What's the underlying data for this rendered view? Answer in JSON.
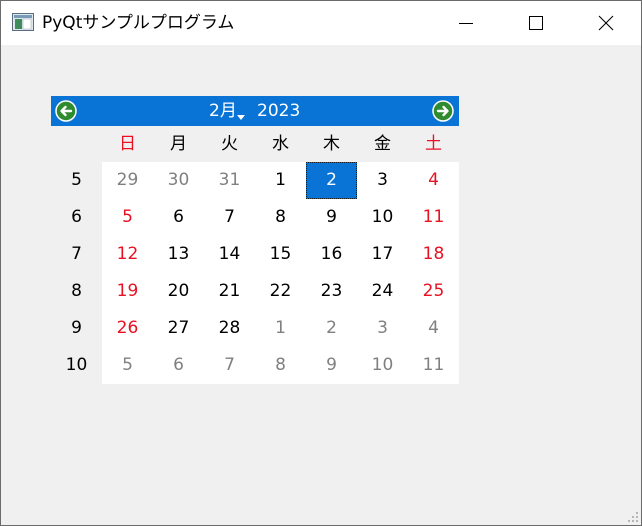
{
  "window": {
    "title": "PyQtサンプルプログラム"
  },
  "calendar": {
    "month": "2月",
    "year": "2023",
    "weekday_headers": [
      "日",
      "月",
      "火",
      "水",
      "木",
      "金",
      "土"
    ],
    "week_numbers": [
      "5",
      "6",
      "7",
      "8",
      "9",
      "10"
    ],
    "weeks": [
      [
        {
          "d": "29",
          "t": "other"
        },
        {
          "d": "30",
          "t": "other"
        },
        {
          "d": "31",
          "t": "other"
        },
        {
          "d": "1",
          "t": "normal"
        },
        {
          "d": "2",
          "t": "selected"
        },
        {
          "d": "3",
          "t": "normal"
        },
        {
          "d": "4",
          "t": "weekend"
        }
      ],
      [
        {
          "d": "5",
          "t": "weekend"
        },
        {
          "d": "6",
          "t": "normal"
        },
        {
          "d": "7",
          "t": "normal"
        },
        {
          "d": "8",
          "t": "normal"
        },
        {
          "d": "9",
          "t": "normal"
        },
        {
          "d": "10",
          "t": "normal"
        },
        {
          "d": "11",
          "t": "weekend"
        }
      ],
      [
        {
          "d": "12",
          "t": "weekend"
        },
        {
          "d": "13",
          "t": "normal"
        },
        {
          "d": "14",
          "t": "normal"
        },
        {
          "d": "15",
          "t": "normal"
        },
        {
          "d": "16",
          "t": "normal"
        },
        {
          "d": "17",
          "t": "normal"
        },
        {
          "d": "18",
          "t": "weekend"
        }
      ],
      [
        {
          "d": "19",
          "t": "weekend"
        },
        {
          "d": "20",
          "t": "normal"
        },
        {
          "d": "21",
          "t": "normal"
        },
        {
          "d": "22",
          "t": "normal"
        },
        {
          "d": "23",
          "t": "normal"
        },
        {
          "d": "24",
          "t": "normal"
        },
        {
          "d": "25",
          "t": "weekend"
        }
      ],
      [
        {
          "d": "26",
          "t": "weekend"
        },
        {
          "d": "27",
          "t": "normal"
        },
        {
          "d": "28",
          "t": "normal"
        },
        {
          "d": "1",
          "t": "other"
        },
        {
          "d": "2",
          "t": "other"
        },
        {
          "d": "3",
          "t": "other"
        },
        {
          "d": "4",
          "t": "other"
        }
      ],
      [
        {
          "d": "5",
          "t": "other"
        },
        {
          "d": "6",
          "t": "other"
        },
        {
          "d": "7",
          "t": "other"
        },
        {
          "d": "8",
          "t": "other"
        },
        {
          "d": "9",
          "t": "other"
        },
        {
          "d": "10",
          "t": "other"
        },
        {
          "d": "11",
          "t": "other"
        }
      ]
    ]
  },
  "colors": {
    "accent": "#0a74d6",
    "weekend": "#e81123",
    "other_month": "#808080",
    "nav_arrow": "#2e8b2e"
  },
  "icons": {
    "app": "app-window-icon",
    "minimize": "minimize-icon",
    "maximize": "maximize-icon",
    "close": "close-icon",
    "prev": "arrow-left-circle-icon",
    "next": "arrow-right-circle-icon",
    "month_menu": "caret-down-icon",
    "grip": "resize-grip-icon"
  }
}
